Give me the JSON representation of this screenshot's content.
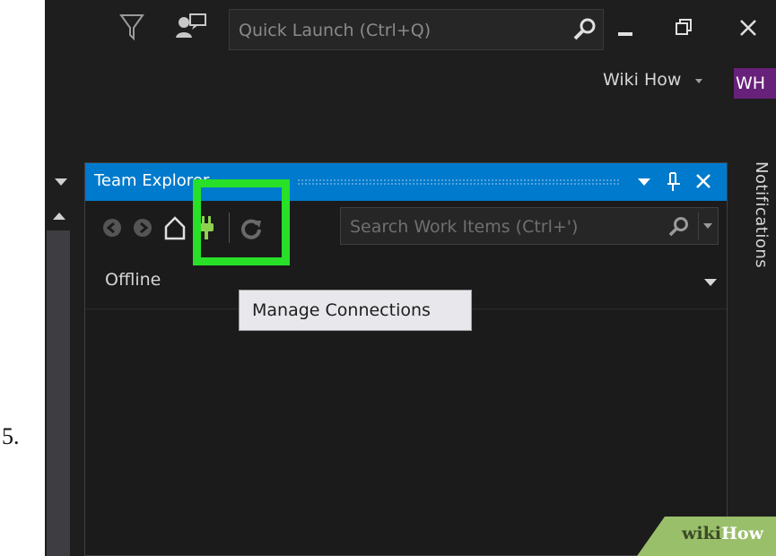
{
  "step": {
    "number": "5."
  },
  "titlebar": {
    "quick_launch_placeholder": "Quick Launch (Ctrl+Q)",
    "icons": [
      "filter-icon",
      "feedback-icon",
      "search-icon",
      "minimize-icon",
      "restore-icon",
      "close-icon"
    ]
  },
  "account": {
    "user_name": "Wiki How",
    "initials": "WH",
    "accent": "#68217a"
  },
  "team_explorer": {
    "title": "Team Explorer",
    "title_bar_color": "#007acc",
    "search_placeholder": "Search Work Items (Ctrl+')",
    "status": "Offline",
    "tooltip": "Manage Connections",
    "highlight_color": "#28e028"
  },
  "notifications": {
    "label": "Notifications"
  },
  "watermark": {
    "wiki": "wiki",
    "how": "How"
  }
}
